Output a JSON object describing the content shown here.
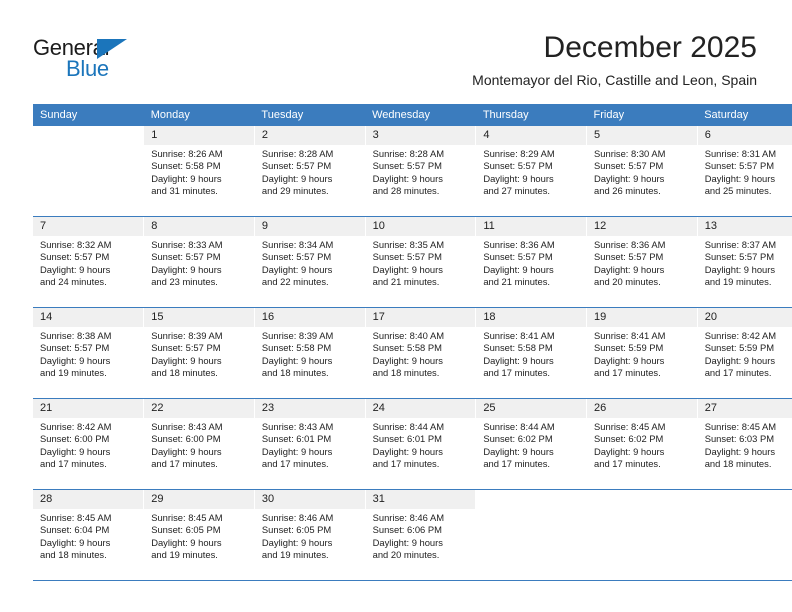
{
  "brand": {
    "name_part1": "General",
    "name_part2": "Blue",
    "accent_color": "#1b75bb"
  },
  "header": {
    "title": "December 2025",
    "subtitle": "Montemayor del Rio, Castille and Leon, Spain"
  },
  "calendar": {
    "header_color": "#3b7cbe",
    "weekday_headers": [
      "Sunday",
      "Monday",
      "Tuesday",
      "Wednesday",
      "Thursday",
      "Friday",
      "Saturday"
    ],
    "weeks": [
      [
        {
          "day": "",
          "lines": []
        },
        {
          "day": "1",
          "lines": [
            "Sunrise: 8:26 AM",
            "Sunset: 5:58 PM",
            "Daylight: 9 hours",
            "and 31 minutes."
          ]
        },
        {
          "day": "2",
          "lines": [
            "Sunrise: 8:28 AM",
            "Sunset: 5:57 PM",
            "Daylight: 9 hours",
            "and 29 minutes."
          ]
        },
        {
          "day": "3",
          "lines": [
            "Sunrise: 8:28 AM",
            "Sunset: 5:57 PM",
            "Daylight: 9 hours",
            "and 28 minutes."
          ]
        },
        {
          "day": "4",
          "lines": [
            "Sunrise: 8:29 AM",
            "Sunset: 5:57 PM",
            "Daylight: 9 hours",
            "and 27 minutes."
          ]
        },
        {
          "day": "5",
          "lines": [
            "Sunrise: 8:30 AM",
            "Sunset: 5:57 PM",
            "Daylight: 9 hours",
            "and 26 minutes."
          ]
        },
        {
          "day": "6",
          "lines": [
            "Sunrise: 8:31 AM",
            "Sunset: 5:57 PM",
            "Daylight: 9 hours",
            "and 25 minutes."
          ]
        }
      ],
      [
        {
          "day": "7",
          "lines": [
            "Sunrise: 8:32 AM",
            "Sunset: 5:57 PM",
            "Daylight: 9 hours",
            "and 24 minutes."
          ]
        },
        {
          "day": "8",
          "lines": [
            "Sunrise: 8:33 AM",
            "Sunset: 5:57 PM",
            "Daylight: 9 hours",
            "and 23 minutes."
          ]
        },
        {
          "day": "9",
          "lines": [
            "Sunrise: 8:34 AM",
            "Sunset: 5:57 PM",
            "Daylight: 9 hours",
            "and 22 minutes."
          ]
        },
        {
          "day": "10",
          "lines": [
            "Sunrise: 8:35 AM",
            "Sunset: 5:57 PM",
            "Daylight: 9 hours",
            "and 21 minutes."
          ]
        },
        {
          "day": "11",
          "lines": [
            "Sunrise: 8:36 AM",
            "Sunset: 5:57 PM",
            "Daylight: 9 hours",
            "and 21 minutes."
          ]
        },
        {
          "day": "12",
          "lines": [
            "Sunrise: 8:36 AM",
            "Sunset: 5:57 PM",
            "Daylight: 9 hours",
            "and 20 minutes."
          ]
        },
        {
          "day": "13",
          "lines": [
            "Sunrise: 8:37 AM",
            "Sunset: 5:57 PM",
            "Daylight: 9 hours",
            "and 19 minutes."
          ]
        }
      ],
      [
        {
          "day": "14",
          "lines": [
            "Sunrise: 8:38 AM",
            "Sunset: 5:57 PM",
            "Daylight: 9 hours",
            "and 19 minutes."
          ]
        },
        {
          "day": "15",
          "lines": [
            "Sunrise: 8:39 AM",
            "Sunset: 5:57 PM",
            "Daylight: 9 hours",
            "and 18 minutes."
          ]
        },
        {
          "day": "16",
          "lines": [
            "Sunrise: 8:39 AM",
            "Sunset: 5:58 PM",
            "Daylight: 9 hours",
            "and 18 minutes."
          ]
        },
        {
          "day": "17",
          "lines": [
            "Sunrise: 8:40 AM",
            "Sunset: 5:58 PM",
            "Daylight: 9 hours",
            "and 18 minutes."
          ]
        },
        {
          "day": "18",
          "lines": [
            "Sunrise: 8:41 AM",
            "Sunset: 5:58 PM",
            "Daylight: 9 hours",
            "and 17 minutes."
          ]
        },
        {
          "day": "19",
          "lines": [
            "Sunrise: 8:41 AM",
            "Sunset: 5:59 PM",
            "Daylight: 9 hours",
            "and 17 minutes."
          ]
        },
        {
          "day": "20",
          "lines": [
            "Sunrise: 8:42 AM",
            "Sunset: 5:59 PM",
            "Daylight: 9 hours",
            "and 17 minutes."
          ]
        }
      ],
      [
        {
          "day": "21",
          "lines": [
            "Sunrise: 8:42 AM",
            "Sunset: 6:00 PM",
            "Daylight: 9 hours",
            "and 17 minutes."
          ]
        },
        {
          "day": "22",
          "lines": [
            "Sunrise: 8:43 AM",
            "Sunset: 6:00 PM",
            "Daylight: 9 hours",
            "and 17 minutes."
          ]
        },
        {
          "day": "23",
          "lines": [
            "Sunrise: 8:43 AM",
            "Sunset: 6:01 PM",
            "Daylight: 9 hours",
            "and 17 minutes."
          ]
        },
        {
          "day": "24",
          "lines": [
            "Sunrise: 8:44 AM",
            "Sunset: 6:01 PM",
            "Daylight: 9 hours",
            "and 17 minutes."
          ]
        },
        {
          "day": "25",
          "lines": [
            "Sunrise: 8:44 AM",
            "Sunset: 6:02 PM",
            "Daylight: 9 hours",
            "and 17 minutes."
          ]
        },
        {
          "day": "26",
          "lines": [
            "Sunrise: 8:45 AM",
            "Sunset: 6:02 PM",
            "Daylight: 9 hours",
            "and 17 minutes."
          ]
        },
        {
          "day": "27",
          "lines": [
            "Sunrise: 8:45 AM",
            "Sunset: 6:03 PM",
            "Daylight: 9 hours",
            "and 18 minutes."
          ]
        }
      ],
      [
        {
          "day": "28",
          "lines": [
            "Sunrise: 8:45 AM",
            "Sunset: 6:04 PM",
            "Daylight: 9 hours",
            "and 18 minutes."
          ]
        },
        {
          "day": "29",
          "lines": [
            "Sunrise: 8:45 AM",
            "Sunset: 6:05 PM",
            "Daylight: 9 hours",
            "and 19 minutes."
          ]
        },
        {
          "day": "30",
          "lines": [
            "Sunrise: 8:46 AM",
            "Sunset: 6:05 PM",
            "Daylight: 9 hours",
            "and 19 minutes."
          ]
        },
        {
          "day": "31",
          "lines": [
            "Sunrise: 8:46 AM",
            "Sunset: 6:06 PM",
            "Daylight: 9 hours",
            "and 20 minutes."
          ]
        },
        {
          "day": "",
          "lines": []
        },
        {
          "day": "",
          "lines": []
        },
        {
          "day": "",
          "lines": []
        }
      ]
    ]
  }
}
